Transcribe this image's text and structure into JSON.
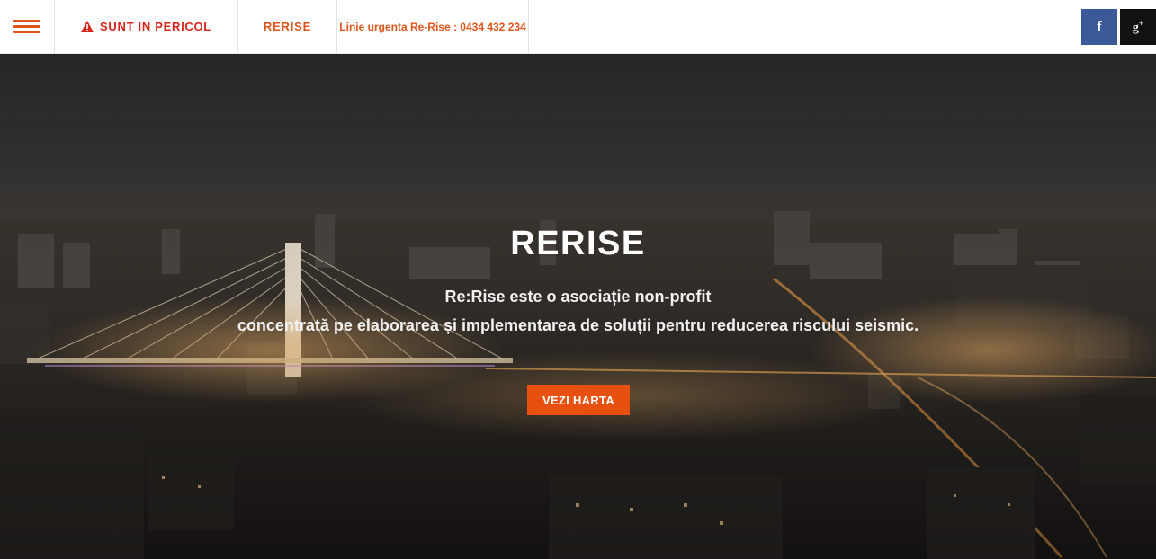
{
  "header": {
    "danger_label": "SUNT IN PERICOL",
    "rerise_label": "RERISE",
    "hotline_label": "Linie urgenta Re-Rise : 0434 432 234",
    "facebook_label": "f",
    "googleplus_label": "g",
    "googleplus_sup": "+"
  },
  "hero": {
    "title": "RERISE",
    "line1": "Re:Rise este o asociație non-profit",
    "line2": "concentrată pe elaborarea și implementarea de soluții pentru reducerea riscului seismic.",
    "cta_label": "VEZI HARTA"
  },
  "colors": {
    "accent": "#e0541a",
    "danger": "#d8261c",
    "cta": "#e8500f",
    "facebook": "#3b5998",
    "googleplus": "#111111"
  },
  "icons": {
    "menu": "hamburger-icon",
    "danger": "warning-icon",
    "facebook": "facebook-icon",
    "googleplus": "google-plus-icon"
  }
}
